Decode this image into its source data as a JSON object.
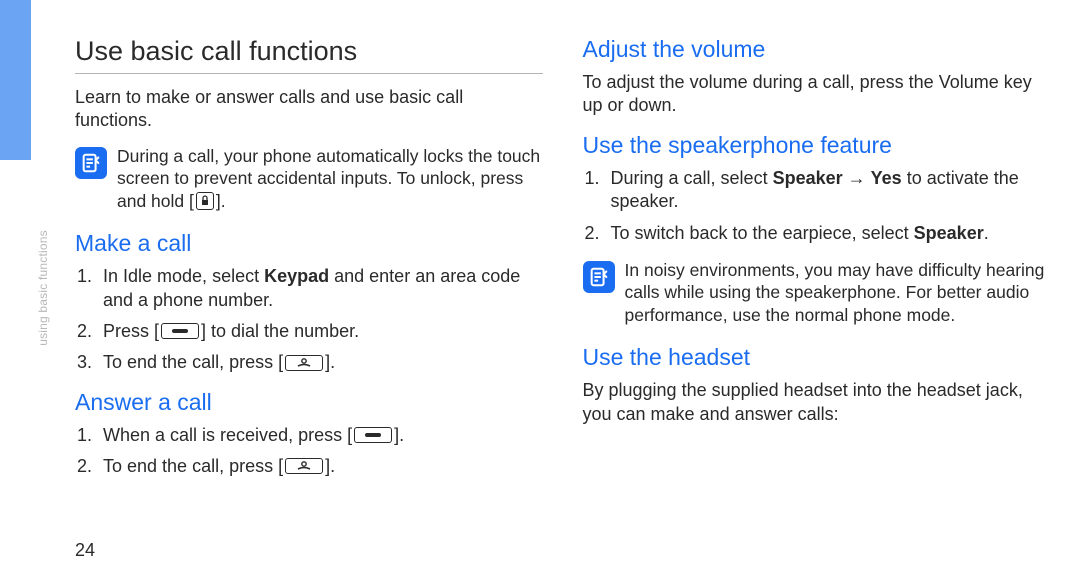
{
  "page_number": "24",
  "sidebar_label": "using basic functions",
  "left": {
    "title": "Use basic call functions",
    "intro": "Learn to make or answer calls and use basic call functions.",
    "note1_a": "During a call, your phone automatically locks the touch screen to prevent accidental inputs. To unlock, press and hold [",
    "note1_b": "].",
    "make_call_head": "Make a call",
    "make_call_1a": "In Idle mode, select ",
    "make_call_1b": "Keypad",
    "make_call_1c": " and enter an area code and a phone number.",
    "make_call_2a": "Press [",
    "make_call_2b": "] to dial the number.",
    "make_call_3a": "To end the call, press [",
    "make_call_3b": "].",
    "answer_head": "Answer a call",
    "answer_1a": "When a call is received, press [",
    "answer_1b": "].",
    "answer_2a": "To end the call, press [",
    "answer_2b": "]."
  },
  "right": {
    "adjust_head": "Adjust the volume",
    "adjust_text": "To adjust the volume during a call, press the Volume key up or down.",
    "speaker_head": "Use the speakerphone feature",
    "speaker_1a": "During a call, select ",
    "speaker_1b": "Speaker",
    "speaker_1c": " → ",
    "speaker_1d": "Yes",
    "speaker_1e": " to activate the speaker.",
    "speaker_2a": "To switch back to the earpiece, select ",
    "speaker_2b": "Speaker",
    "speaker_2c": ".",
    "note2": "In noisy environments, you may have difficulty hearing calls while using the speakerphone. For better audio performance, use the normal phone mode.",
    "headset_head": "Use the headset",
    "headset_text": "By plugging the supplied headset into the headset jack, you can make and answer calls:"
  }
}
